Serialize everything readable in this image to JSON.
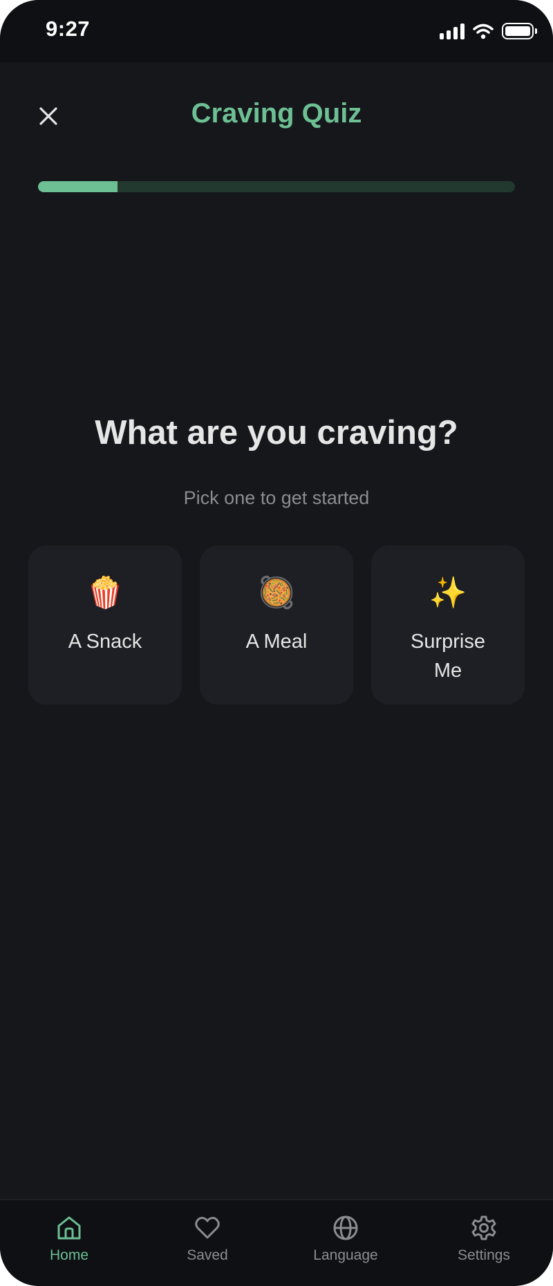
{
  "status_bar": {
    "time": "9:27",
    "icons": [
      "signal-icon",
      "wifi-icon",
      "battery-icon"
    ]
  },
  "header": {
    "title": "Craving Quiz",
    "close_icon": "close-icon"
  },
  "progress": {
    "fraction": 0.167
  },
  "quiz": {
    "question": "What are you craving?",
    "subtitle": "Pick one to get started",
    "options": [
      {
        "emoji": "🍿",
        "label": "A Snack"
      },
      {
        "emoji": "🥘",
        "label": "A Meal"
      },
      {
        "emoji": "✨",
        "label": "Surprise Me"
      }
    ]
  },
  "tab_bar": {
    "tabs": [
      {
        "label": "Home",
        "icon": "home-icon",
        "active": true
      },
      {
        "label": "Saved",
        "icon": "heart-icon",
        "active": false
      },
      {
        "label": "Language",
        "icon": "globe-icon",
        "active": false
      },
      {
        "label": "Settings",
        "icon": "gear-icon",
        "active": false
      }
    ]
  },
  "colors": {
    "accent": "#6dbf94",
    "background": "#16171b",
    "card": "#1e1f24",
    "progress_track": "#22392f"
  }
}
